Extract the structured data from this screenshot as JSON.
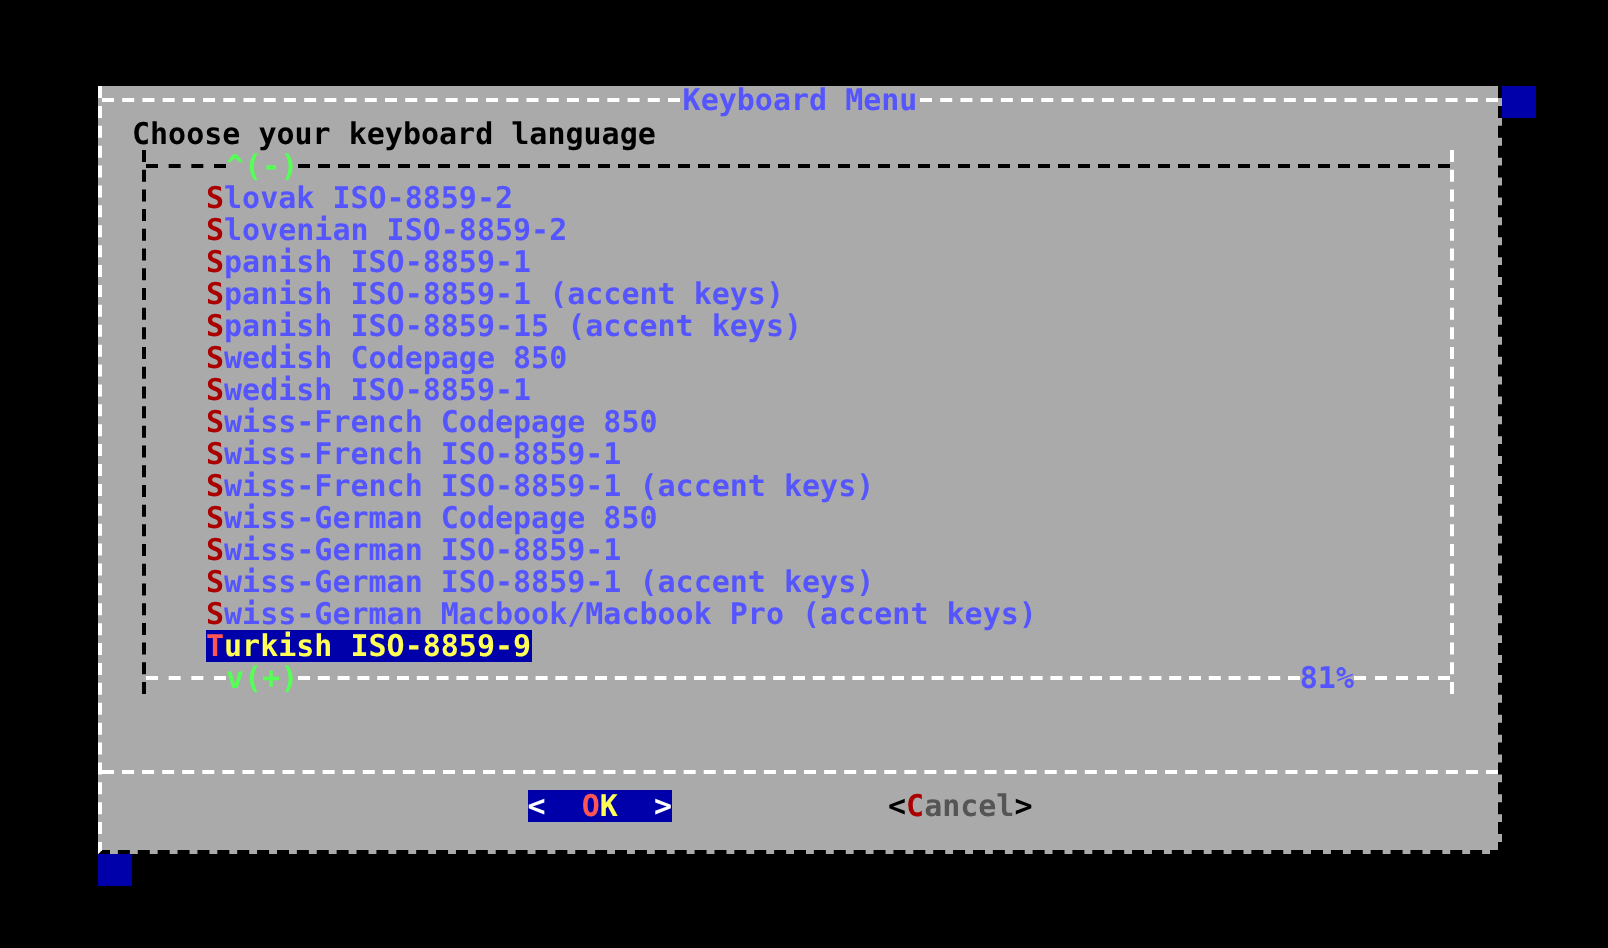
{
  "dialog": {
    "title": "Keyboard Menu",
    "prompt": "Choose your keyboard language"
  },
  "list": {
    "scroll_up": "^(-)",
    "scroll_down": "v(+)",
    "percent": "81%",
    "items": [
      {
        "label": "Slovak ISO-8859-2",
        "selected": false
      },
      {
        "label": "Slovenian ISO-8859-2",
        "selected": false
      },
      {
        "label": "Spanish ISO-8859-1",
        "selected": false
      },
      {
        "label": "Spanish ISO-8859-1 (accent keys)",
        "selected": false
      },
      {
        "label": "Spanish ISO-8859-15 (accent keys)",
        "selected": false
      },
      {
        "label": "Swedish Codepage 850",
        "selected": false
      },
      {
        "label": "Swedish ISO-8859-1",
        "selected": false
      },
      {
        "label": "Swiss-French Codepage 850",
        "selected": false
      },
      {
        "label": "Swiss-French ISO-8859-1",
        "selected": false
      },
      {
        "label": "Swiss-French ISO-8859-1 (accent keys)",
        "selected": false
      },
      {
        "label": "Swiss-German Codepage 850",
        "selected": false
      },
      {
        "label": "Swiss-German ISO-8859-1",
        "selected": false
      },
      {
        "label": "Swiss-German ISO-8859-1 (accent keys)",
        "selected": false
      },
      {
        "label": "Swiss-German Macbook/Macbook Pro (accent keys)",
        "selected": false
      },
      {
        "label": "Turkish ISO-8859-9",
        "selected": true
      }
    ]
  },
  "buttons": [
    {
      "open": "<",
      "label": "OK",
      "close": ">",
      "selected": true
    },
    {
      "open": "<",
      "label": "Cancel",
      "close": ">",
      "selected": false
    }
  ]
}
